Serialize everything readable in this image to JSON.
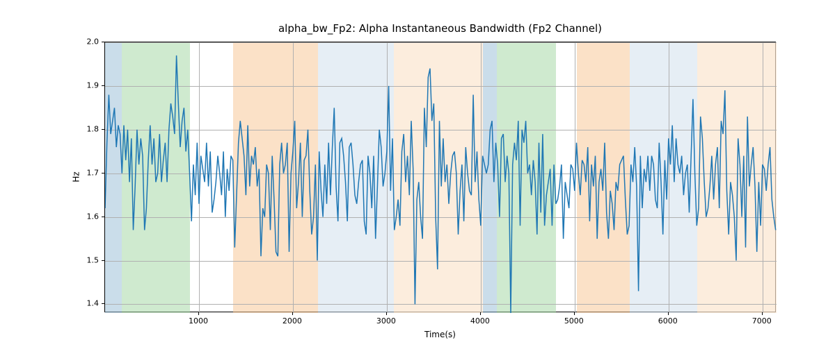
{
  "chart_data": {
    "type": "line",
    "title": "alpha_bw_Fp2: Alpha Instantaneous Bandwidth (Fp2 Channel)",
    "xlabel": "Time(s)",
    "ylabel": "Hz",
    "xlim": [
      0,
      7150
    ],
    "ylim": [
      1.38,
      2.0
    ],
    "xticks": [
      1000,
      2000,
      3000,
      4000,
      5000,
      6000,
      7000
    ],
    "yticks": [
      1.4,
      1.5,
      1.6,
      1.7,
      1.8,
      1.9,
      2.0
    ],
    "grid": true,
    "bands": [
      {
        "x0": 0,
        "x1": 175,
        "color": "#9ec1d9",
        "opacity": 0.55
      },
      {
        "x0": 175,
        "x1": 905,
        "color": "#a8d8a8",
        "opacity": 0.55
      },
      {
        "x0": 1365,
        "x1": 2265,
        "color": "#f7c999",
        "opacity": 0.55
      },
      {
        "x0": 2265,
        "x1": 3075,
        "color": "#d2e0ed",
        "opacity": 0.55
      },
      {
        "x0": 3075,
        "x1": 3200,
        "color": "#fbe5cf",
        "opacity": 0.7
      },
      {
        "x0": 3200,
        "x1": 4020,
        "color": "#fbe5cf",
        "opacity": 0.7
      },
      {
        "x0": 4020,
        "x1": 4175,
        "color": "#9ec1d9",
        "opacity": 0.55
      },
      {
        "x0": 4175,
        "x1": 4800,
        "color": "#a8d8a8",
        "opacity": 0.55
      },
      {
        "x0": 5020,
        "x1": 5590,
        "color": "#f7c999",
        "opacity": 0.55
      },
      {
        "x0": 5590,
        "x1": 6305,
        "color": "#d2e0ed",
        "opacity": 0.55
      },
      {
        "x0": 6305,
        "x1": 7150,
        "color": "#fbe5cf",
        "opacity": 0.7
      }
    ],
    "x": [
      0,
      20,
      40,
      60,
      80,
      100,
      120,
      140,
      160,
      180,
      200,
      220,
      240,
      260,
      280,
      300,
      320,
      340,
      360,
      380,
      400,
      420,
      440,
      460,
      480,
      500,
      520,
      540,
      560,
      580,
      600,
      620,
      640,
      660,
      680,
      700,
      720,
      740,
      760,
      780,
      800,
      820,
      840,
      860,
      880,
      900,
      920,
      940,
      960,
      980,
      1000,
      1020,
      1040,
      1060,
      1080,
      1100,
      1120,
      1140,
      1160,
      1180,
      1200,
      1220,
      1240,
      1260,
      1280,
      1300,
      1320,
      1340,
      1360,
      1380,
      1400,
      1420,
      1440,
      1460,
      1480,
      1500,
      1520,
      1540,
      1560,
      1580,
      1600,
      1620,
      1640,
      1660,
      1680,
      1700,
      1720,
      1740,
      1760,
      1780,
      1800,
      1820,
      1840,
      1860,
      1880,
      1900,
      1920,
      1940,
      1960,
      1980,
      2000,
      2020,
      2040,
      2060,
      2080,
      2100,
      2120,
      2140,
      2160,
      2180,
      2200,
      2220,
      2240,
      2260,
      2280,
      2300,
      2320,
      2340,
      2360,
      2380,
      2400,
      2420,
      2440,
      2460,
      2480,
      2500,
      2520,
      2540,
      2560,
      2580,
      2600,
      2620,
      2640,
      2660,
      2680,
      2700,
      2720,
      2740,
      2760,
      2780,
      2800,
      2820,
      2840,
      2860,
      2880,
      2900,
      2920,
      2940,
      2960,
      2980,
      3000,
      3020,
      3040,
      3060,
      3080,
      3100,
      3120,
      3140,
      3160,
      3180,
      3200,
      3220,
      3240,
      3260,
      3280,
      3300,
      3320,
      3340,
      3360,
      3380,
      3400,
      3420,
      3440,
      3460,
      3480,
      3500,
      3520,
      3540,
      3560,
      3580,
      3600,
      3620,
      3640,
      3660,
      3680,
      3700,
      3720,
      3740,
      3760,
      3780,
      3800,
      3820,
      3840,
      3860,
      3880,
      3900,
      3920,
      3940,
      3960,
      3980,
      4000,
      4020,
      4040,
      4060,
      4080,
      4100,
      4120,
      4140,
      4160,
      4180,
      4200,
      4220,
      4240,
      4260,
      4280,
      4300,
      4320,
      4340,
      4360,
      4380,
      4400,
      4420,
      4440,
      4460,
      4480,
      4500,
      4520,
      4540,
      4560,
      4580,
      4600,
      4620,
      4640,
      4660,
      4680,
      4700,
      4720,
      4740,
      4760,
      4780,
      4800,
      4820,
      4840,
      4860,
      4880,
      4900,
      4920,
      4940,
      4960,
      4980,
      5000,
      5020,
      5040,
      5060,
      5080,
      5100,
      5120,
      5140,
      5160,
      5180,
      5200,
      5220,
      5240,
      5260,
      5280,
      5300,
      5320,
      5340,
      5360,
      5380,
      5400,
      5420,
      5440,
      5460,
      5480,
      5500,
      5520,
      5540,
      5560,
      5580,
      5600,
      5620,
      5640,
      5660,
      5680,
      5700,
      5720,
      5740,
      5760,
      5780,
      5800,
      5820,
      5840,
      5860,
      5880,
      5900,
      5920,
      5940,
      5960,
      5980,
      6000,
      6020,
      6040,
      6060,
      6080,
      6100,
      6120,
      6140,
      6160,
      6180,
      6200,
      6220,
      6240,
      6260,
      6280,
      6300,
      6320,
      6340,
      6360,
      6380,
      6400,
      6420,
      6440,
      6460,
      6480,
      6500,
      6520,
      6540,
      6560,
      6580,
      6600,
      6620,
      6640,
      6660,
      6680,
      6700,
      6720,
      6740,
      6760,
      6780,
      6800,
      6820,
      6840,
      6860,
      6880,
      6900,
      6920,
      6940,
      6960,
      6980,
      7000,
      7020,
      7040,
      7060,
      7080,
      7100,
      7120,
      7140
    ],
    "y": [
      1.62,
      1.77,
      1.88,
      1.79,
      1.82,
      1.85,
      1.76,
      1.81,
      1.79,
      1.7,
      1.81,
      1.73,
      1.8,
      1.68,
      1.78,
      1.57,
      1.67,
      1.8,
      1.72,
      1.78,
      1.74,
      1.57,
      1.62,
      1.73,
      1.81,
      1.72,
      1.78,
      1.68,
      1.7,
      1.79,
      1.68,
      1.73,
      1.77,
      1.68,
      1.8,
      1.86,
      1.83,
      1.79,
      1.97,
      1.86,
      1.76,
      1.82,
      1.85,
      1.75,
      1.8,
      1.7,
      1.59,
      1.72,
      1.65,
      1.77,
      1.63,
      1.74,
      1.71,
      1.68,
      1.77,
      1.67,
      1.75,
      1.61,
      1.64,
      1.68,
      1.74,
      1.7,
      1.65,
      1.75,
      1.6,
      1.71,
      1.66,
      1.74,
      1.73,
      1.53,
      1.65,
      1.77,
      1.82,
      1.78,
      1.74,
      1.65,
      1.81,
      1.67,
      1.74,
      1.72,
      1.76,
      1.67,
      1.71,
      1.51,
      1.62,
      1.6,
      1.72,
      1.7,
      1.57,
      1.74,
      1.64,
      1.52,
      1.51,
      1.72,
      1.77,
      1.7,
      1.72,
      1.77,
      1.52,
      1.7,
      1.75,
      1.82,
      1.62,
      1.68,
      1.77,
      1.6,
      1.73,
      1.74,
      1.8,
      1.66,
      1.56,
      1.6,
      1.72,
      1.5,
      1.75,
      1.66,
      1.6,
      1.72,
      1.63,
      1.77,
      1.65,
      1.76,
      1.85,
      1.67,
      1.59,
      1.77,
      1.78,
      1.74,
      1.68,
      1.59,
      1.76,
      1.77,
      1.72,
      1.65,
      1.63,
      1.68,
      1.72,
      1.73,
      1.59,
      1.56,
      1.74,
      1.7,
      1.62,
      1.74,
      1.55,
      1.67,
      1.8,
      1.76,
      1.67,
      1.7,
      1.75,
      1.9,
      1.66,
      1.78,
      1.57,
      1.6,
      1.64,
      1.58,
      1.75,
      1.79,
      1.68,
      1.74,
      1.65,
      1.82,
      1.71,
      1.4,
      1.64,
      1.68,
      1.6,
      1.55,
      1.85,
      1.76,
      1.92,
      1.94,
      1.82,
      1.86,
      1.6,
      1.48,
      1.82,
      1.67,
      1.78,
      1.68,
      1.72,
      1.63,
      1.7,
      1.74,
      1.75,
      1.7,
      1.56,
      1.66,
      1.72,
      1.59,
      1.76,
      1.7,
      1.66,
      1.65,
      1.88,
      1.68,
      1.75,
      1.64,
      1.58,
      1.74,
      1.72,
      1.7,
      1.72,
      1.8,
      1.82,
      1.68,
      1.77,
      1.72,
      1.6,
      1.78,
      1.79,
      1.68,
      1.74,
      1.7,
      1.38,
      1.72,
      1.77,
      1.73,
      1.82,
      1.58,
      1.8,
      1.77,
      1.82,
      1.7,
      1.72,
      1.65,
      1.73,
      1.68,
      1.56,
      1.77,
      1.61,
      1.79,
      1.58,
      1.65,
      1.68,
      1.71,
      1.58,
      1.72,
      1.63,
      1.64,
      1.67,
      1.72,
      1.55,
      1.68,
      1.65,
      1.62,
      1.72,
      1.71,
      1.66,
      1.77,
      1.7,
      1.65,
      1.73,
      1.72,
      1.68,
      1.76,
      1.59,
      1.72,
      1.67,
      1.74,
      1.55,
      1.68,
      1.71,
      1.66,
      1.77,
      1.61,
      1.55,
      1.66,
      1.63,
      1.57,
      1.68,
      1.66,
      1.72,
      1.73,
      1.74,
      1.64,
      1.56,
      1.58,
      1.72,
      1.68,
      1.76,
      1.67,
      1.43,
      1.74,
      1.62,
      1.71,
      1.68,
      1.74,
      1.66,
      1.74,
      1.72,
      1.64,
      1.62,
      1.77,
      1.68,
      1.56,
      1.73,
      1.64,
      1.78,
      1.72,
      1.81,
      1.68,
      1.78,
      1.72,
      1.7,
      1.74,
      1.65,
      1.7,
      1.72,
      1.61,
      1.74,
      1.87,
      1.7,
      1.58,
      1.62,
      1.83,
      1.78,
      1.68,
      1.6,
      1.62,
      1.67,
      1.74,
      1.64,
      1.72,
      1.76,
      1.62,
      1.82,
      1.79,
      1.89,
      1.66,
      1.56,
      1.68,
      1.65,
      1.6,
      1.5,
      1.78,
      1.72,
      1.6,
      1.74,
      1.53,
      1.83,
      1.67,
      1.72,
      1.76,
      1.67,
      1.52,
      1.68,
      1.58,
      1.72,
      1.71,
      1.66,
      1.72,
      1.76,
      1.64,
      1.6,
      1.57
    ]
  }
}
